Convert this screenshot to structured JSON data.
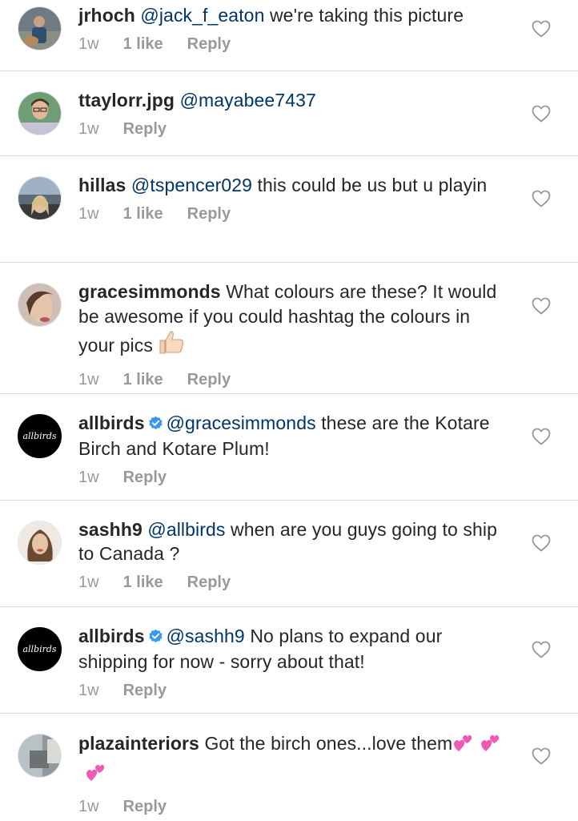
{
  "comments": [
    {
      "username": "jrhoch",
      "mention": "@jack_f_eaton",
      "text": " we're taking this picture",
      "time": "1w",
      "likes": "1 like",
      "reply": "Reply"
    },
    {
      "username": "ttaylorr.jpg",
      "mention": "@mayabee7437",
      "text": "",
      "time": "1w",
      "reply": "Reply"
    },
    {
      "username": "hillas",
      "mention": "@tspencer029",
      "text": " this could be us but u playin",
      "time": "1w",
      "likes": "1 like",
      "reply": "Reply"
    },
    {
      "username": "gracesimmonds",
      "mention": "",
      "text": " What colours are these? It would be awesome if you could hashtag the colours in your pics",
      "time": "1w",
      "likes": "1 like",
      "reply": "Reply"
    },
    {
      "username": "allbirds",
      "mention": "@gracesimmonds",
      "text": " these are the Kotare Birch and Kotare Plum!",
      "time": "1w",
      "reply": "Reply"
    },
    {
      "username": "sashh9",
      "mention": "@allbirds",
      "text": " when are you guys going to ship to Canada ?",
      "time": "1w",
      "likes": "1 like",
      "reply": "Reply"
    },
    {
      "username": "allbirds",
      "mention": "@sashh9",
      "text": " No plans to expand our shipping for now - sorry about that!",
      "time": "1w",
      "reply": "Reply"
    },
    {
      "username": "plazainteriors",
      "mention": "",
      "text": " Got the birch ones...love them",
      "time": "1w",
      "reply": "Reply"
    }
  ],
  "brand_logo_text": "allbirds",
  "colors": {
    "mention": "#003569",
    "meta": "#999999",
    "divider": "#dbdbdb",
    "verified": "#3897f0"
  }
}
